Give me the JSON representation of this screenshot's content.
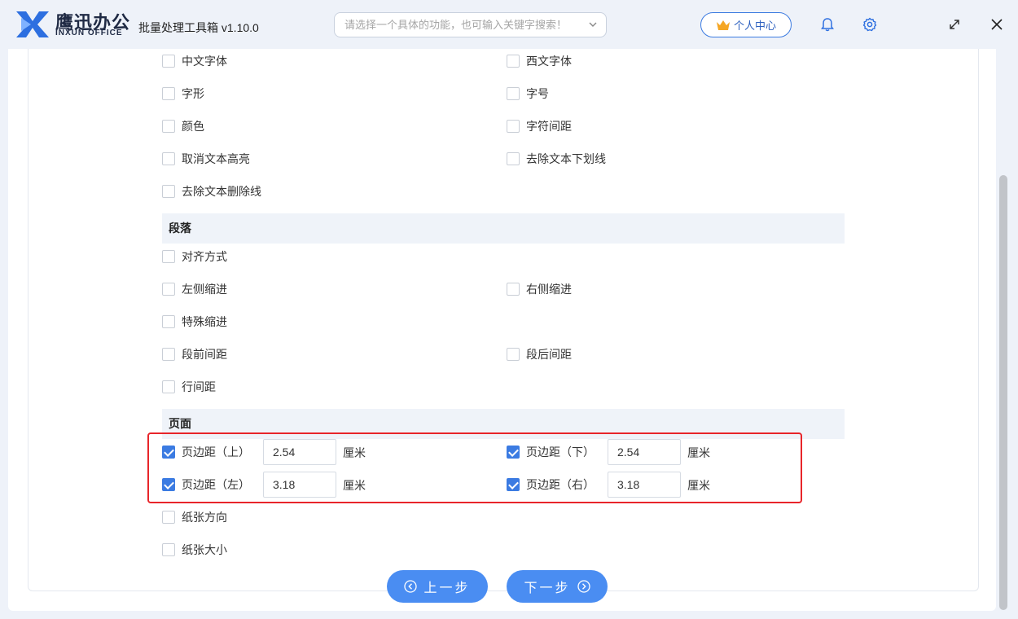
{
  "app": {
    "logo_cn": "鹰迅办公",
    "logo_en": "INXUN OFFICE",
    "title": "批量处理工具箱 v1.10.0",
    "search_placeholder": "请选择一个具体的功能，也可输入关键字搜索！",
    "user_center": "个人中心",
    "icons": [
      "bell-icon",
      "gear-icon",
      "maximize-icon",
      "close-icon"
    ],
    "accent_color": "#4a8df2"
  },
  "font_options": [
    {
      "label": "中文字体",
      "checked": false
    },
    {
      "label": "西文字体",
      "checked": false
    },
    {
      "label": "字形",
      "checked": false
    },
    {
      "label": "字号",
      "checked": false
    },
    {
      "label": "颜色",
      "checked": false
    },
    {
      "label": "字符间距",
      "checked": false
    },
    {
      "label": "取消文本高亮",
      "checked": false
    },
    {
      "label": "去除文本下划线",
      "checked": false
    },
    {
      "label": "去除文本删除线",
      "checked": false
    }
  ],
  "paragraph": {
    "heading": "段落",
    "options": [
      {
        "label": "对齐方式",
        "checked": false
      },
      {
        "label": "左侧缩进",
        "checked": false
      },
      {
        "label": "右侧缩进",
        "checked": false
      },
      {
        "label": "特殊缩进",
        "checked": false
      },
      {
        "label": "段前间距",
        "checked": false
      },
      {
        "label": "段后间距",
        "checked": false
      },
      {
        "label": "行间距",
        "checked": false
      }
    ]
  },
  "page": {
    "heading": "页面",
    "margins": [
      {
        "label": "页边距（上）",
        "checked": true,
        "value": "2.54",
        "unit": "厘米"
      },
      {
        "label": "页边距（下）",
        "checked": true,
        "value": "2.54",
        "unit": "厘米"
      },
      {
        "label": "页边距（左）",
        "checked": true,
        "value": "3.18",
        "unit": "厘米"
      },
      {
        "label": "页边距（右）",
        "checked": true,
        "value": "3.18",
        "unit": "厘米"
      }
    ],
    "options": [
      {
        "label": "纸张方向",
        "checked": false
      },
      {
        "label": "纸张大小",
        "checked": false
      }
    ]
  },
  "nav": {
    "prev": "上一步",
    "next": "下一步"
  },
  "highlight_color": "#e8252a"
}
